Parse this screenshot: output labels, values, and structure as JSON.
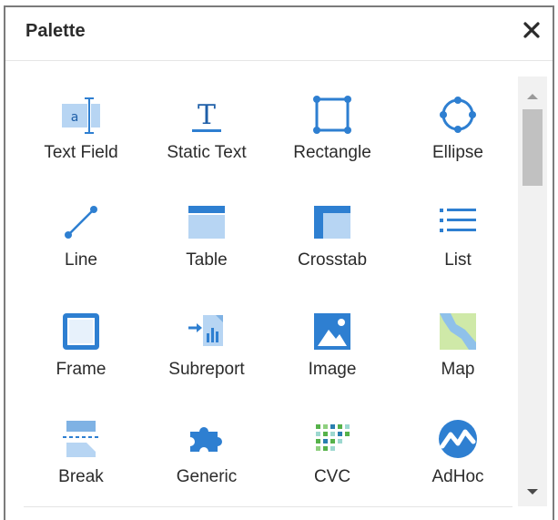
{
  "panel": {
    "title": "Palette",
    "close_icon": "close-icon"
  },
  "items": [
    {
      "label": "Text Field",
      "icon": "text-field-icon"
    },
    {
      "label": "Static Text",
      "icon": "static-text-icon"
    },
    {
      "label": "Rectangle",
      "icon": "rectangle-icon"
    },
    {
      "label": "Ellipse",
      "icon": "ellipse-icon"
    },
    {
      "label": "Line",
      "icon": "line-icon"
    },
    {
      "label": "Table",
      "icon": "table-icon"
    },
    {
      "label": "Crosstab",
      "icon": "crosstab-icon"
    },
    {
      "label": "List",
      "icon": "list-icon"
    },
    {
      "label": "Frame",
      "icon": "frame-icon"
    },
    {
      "label": "Subreport",
      "icon": "subreport-icon"
    },
    {
      "label": "Image",
      "icon": "image-icon"
    },
    {
      "label": "Map",
      "icon": "map-icon"
    },
    {
      "label": "Break",
      "icon": "break-icon"
    },
    {
      "label": "Generic",
      "icon": "generic-icon"
    },
    {
      "label": "CVC",
      "icon": "cvc-icon"
    },
    {
      "label": "AdHoc",
      "icon": "adhoc-icon"
    }
  ],
  "colors": {
    "accent": "#3a87d6",
    "accent_light": "#a9cdf0",
    "green": "#56b24a",
    "map_fill": "#cfe9a8"
  }
}
